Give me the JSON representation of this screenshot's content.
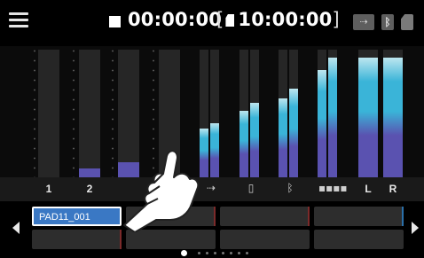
{
  "header": {
    "time": "00:00:00",
    "bracket_open": "[",
    "remaining": "10:00:00",
    "bracket_close": "]"
  },
  "status_icons": [
    "usb-icon",
    "bluetooth-icon",
    "sd-card-icon"
  ],
  "channels": [
    {
      "label": "1",
      "type": "text",
      "level": 0.0
    },
    {
      "label": "2",
      "type": "text",
      "level": 0.07
    },
    {
      "label": "",
      "type": "text",
      "level": 0.12
    },
    {
      "label": "",
      "type": "text",
      "level": 0.0
    },
    {
      "label": "usb",
      "type": "icon",
      "icon": "usb-icon",
      "level": 0.38
    },
    {
      "label": "phone",
      "type": "icon",
      "icon": "phone-icon",
      "level": 0.52
    },
    {
      "label": "bluetooth",
      "type": "icon",
      "icon": "bluetooth-icon",
      "level": 0.62
    },
    {
      "label": "",
      "type": "icon",
      "icon": "mic-array-icon",
      "level": 0.84
    },
    {
      "label": "L",
      "type": "text",
      "level": 0.94
    },
    {
      "label": "R",
      "type": "text",
      "level": 0.94
    }
  ],
  "pads": {
    "row1": [
      "PAD11_001",
      "",
      "",
      ""
    ],
    "row2": [
      "",
      "",
      "",
      ""
    ]
  },
  "page_dots": 8,
  "active_page": 0,
  "colors": {
    "meter_low": "#5a52b0",
    "meter_mid": "#3ab4d8",
    "meter_high": "#bde6ef",
    "pad_selected": "#3a78c4"
  }
}
